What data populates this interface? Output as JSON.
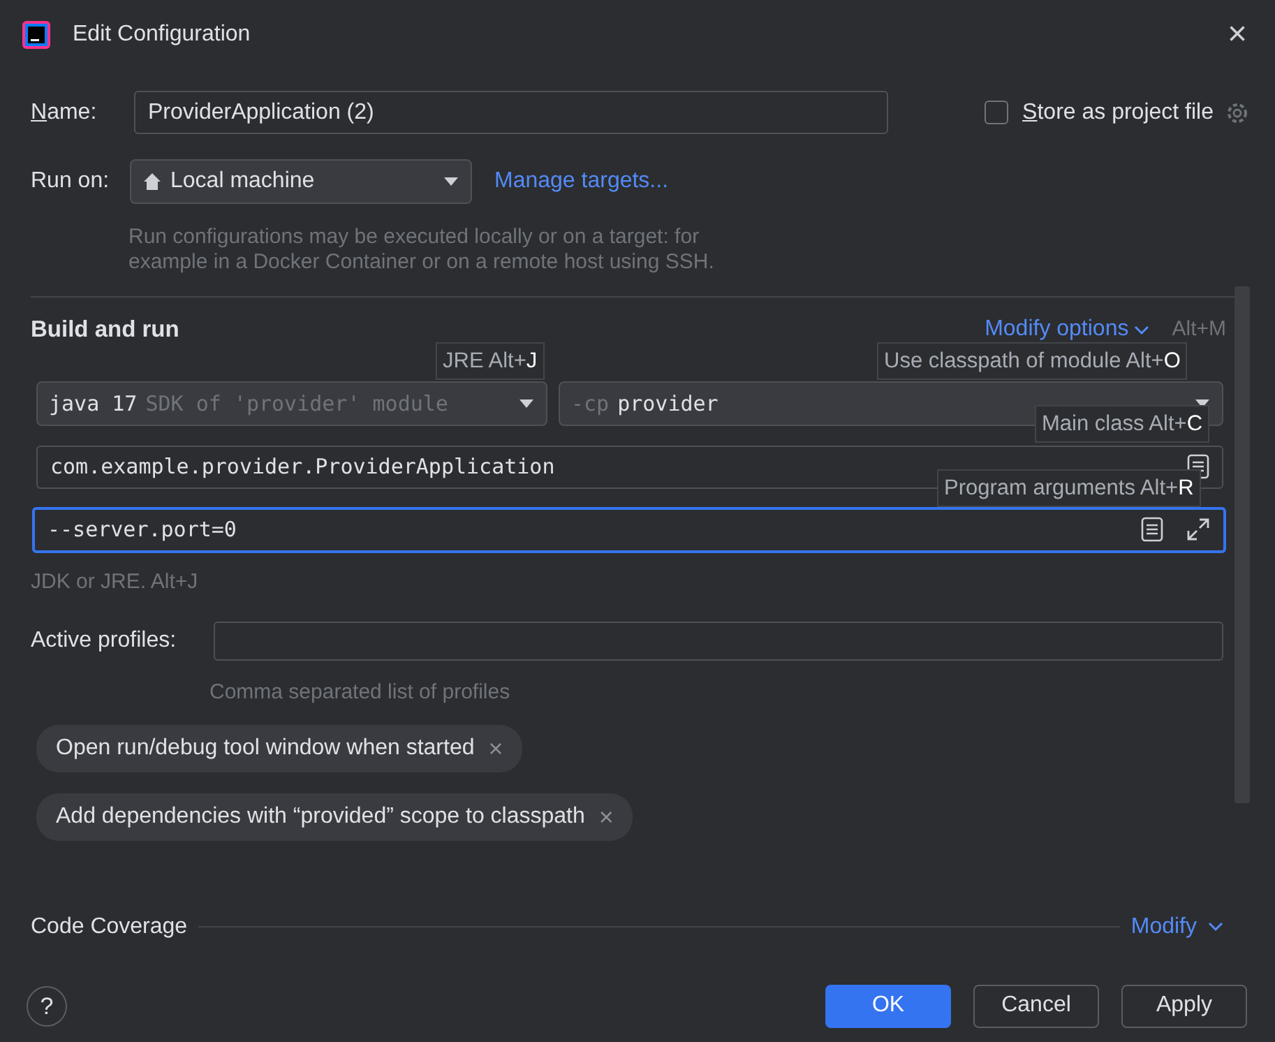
{
  "window": {
    "title": "Edit Configuration",
    "close": "×"
  },
  "name": {
    "label": "Name:",
    "value": "ProviderApplication (2)"
  },
  "store_as_project_file": {
    "label": "Store as project file",
    "checked": false
  },
  "run_on": {
    "label": "Run on:",
    "value": "Local machine",
    "link": "Manage targets...",
    "help_lines": [
      "Run configurations may be executed locally or on a target: for",
      "example in a Docker Container or on a remote host using SSH."
    ]
  },
  "build_and_run": {
    "title": "Build and run",
    "modify_options": {
      "label": "Modify options",
      "shortcut": "Alt+M"
    },
    "jre": {
      "value": "java 17",
      "hint": "SDK of 'provider' module"
    },
    "classpath": {
      "prefix": "-cp",
      "value": "provider"
    },
    "main_class": {
      "value": "com.example.provider.ProviderApplication"
    },
    "program_arguments": {
      "value": "--server.port=0",
      "focused": true
    },
    "hint": "JDK or JRE. Alt+J"
  },
  "tooltips": [
    {
      "text": "JRE Alt+",
      "key": "J"
    },
    {
      "text": "Use classpath of module Alt+",
      "key": "O"
    },
    {
      "text": "Main class Alt+",
      "key": "C"
    },
    {
      "text": "Program arguments Alt+",
      "key": "R"
    }
  ],
  "active_profiles": {
    "label": "Active profiles:",
    "hint": "Comma separated list of profiles"
  },
  "options": [
    {
      "label": "Open run/debug tool window when started",
      "remove": "×"
    },
    {
      "label": "Add dependencies with “provided” scope to classpath",
      "remove": "×"
    }
  ],
  "code_coverage": {
    "title": "Code Coverage",
    "link": "Modify"
  },
  "help_button": "?",
  "buttons": [
    {
      "label": "OK",
      "kind": "primary"
    },
    {
      "label": "Cancel",
      "kind": "secondary"
    },
    {
      "label": "Apply",
      "kind": "secondary"
    }
  ]
}
